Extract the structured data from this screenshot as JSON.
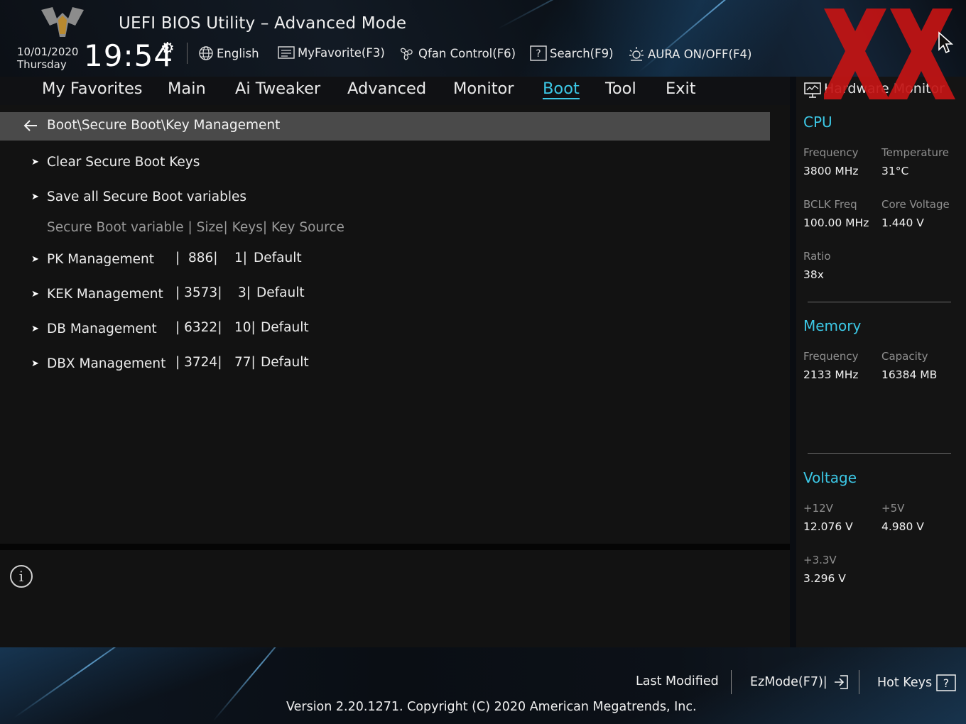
{
  "app": {
    "title": "UEFI BIOS Utility – Advanced Mode",
    "date": "10/01/2020",
    "day": "Thursday",
    "time": "19:54"
  },
  "toolbar": {
    "language": "English",
    "myfavorite": "MyFavorite(F3)",
    "qfan": "Qfan Control(F6)",
    "search": "Search(F9)",
    "aura": "AURA ON/OFF(F4)"
  },
  "menu": {
    "items": [
      "My Favorites",
      "Main",
      "Ai Tweaker",
      "Advanced",
      "Monitor",
      "Boot",
      "Tool",
      "Exit"
    ],
    "active": "Boot"
  },
  "breadcrumb": "Boot\\Secure Boot\\Key Management",
  "actions": {
    "clear_keys": "Clear Secure Boot Keys",
    "save_vars": "Save all Secure Boot variables"
  },
  "table": {
    "header": "Secure Boot variable  |  Size|  Keys|  Key Source",
    "rows": [
      {
        "name": "PK Management",
        "size": "|  886|",
        "keys": "1|",
        "source": "Default"
      },
      {
        "name": "KEK Management",
        "size": "| 3573|",
        "keys": "3|",
        "source": "Default"
      },
      {
        "name": "DB Management",
        "size": "| 6322|",
        "keys": "10|",
        "source": "Default"
      },
      {
        "name": "DBX Management",
        "size": "| 3724|",
        "keys": "77|",
        "source": "Default"
      }
    ]
  },
  "hardware_monitor": {
    "title": "Hardware Monitor",
    "cpu": {
      "heading": "CPU",
      "frequency_label": "Frequency",
      "frequency": "3800 MHz",
      "temperature_label": "Temperature",
      "temperature": "31°C",
      "bclk_label": "BCLK Freq",
      "bclk": "100.00 MHz",
      "core_voltage_label": "Core Voltage",
      "core_voltage": "1.440 V",
      "ratio_label": "Ratio",
      "ratio": "38x"
    },
    "memory": {
      "heading": "Memory",
      "frequency_label": "Frequency",
      "frequency": "2133 MHz",
      "capacity_label": "Capacity",
      "capacity": "16384 MB"
    },
    "voltage": {
      "heading": "Voltage",
      "v12_label": "+12V",
      "v12": "12.076 V",
      "v5_label": "+5V",
      "v5": "4.980 V",
      "v33_label": "+3.3V",
      "v33": "3.296 V"
    }
  },
  "footer": {
    "last_modified": "Last Modified",
    "ezmode": "EzMode(F7)|",
    "hotkeys": "Hot Keys",
    "version": "Version 2.20.1271. Copyright (C) 2020 American Megatrends, Inc."
  },
  "colors": {
    "accent": "#3cc8e6",
    "watermark": "#c41414",
    "panel": "#121212",
    "breadcrumb_bg": "#4a4a4a"
  }
}
